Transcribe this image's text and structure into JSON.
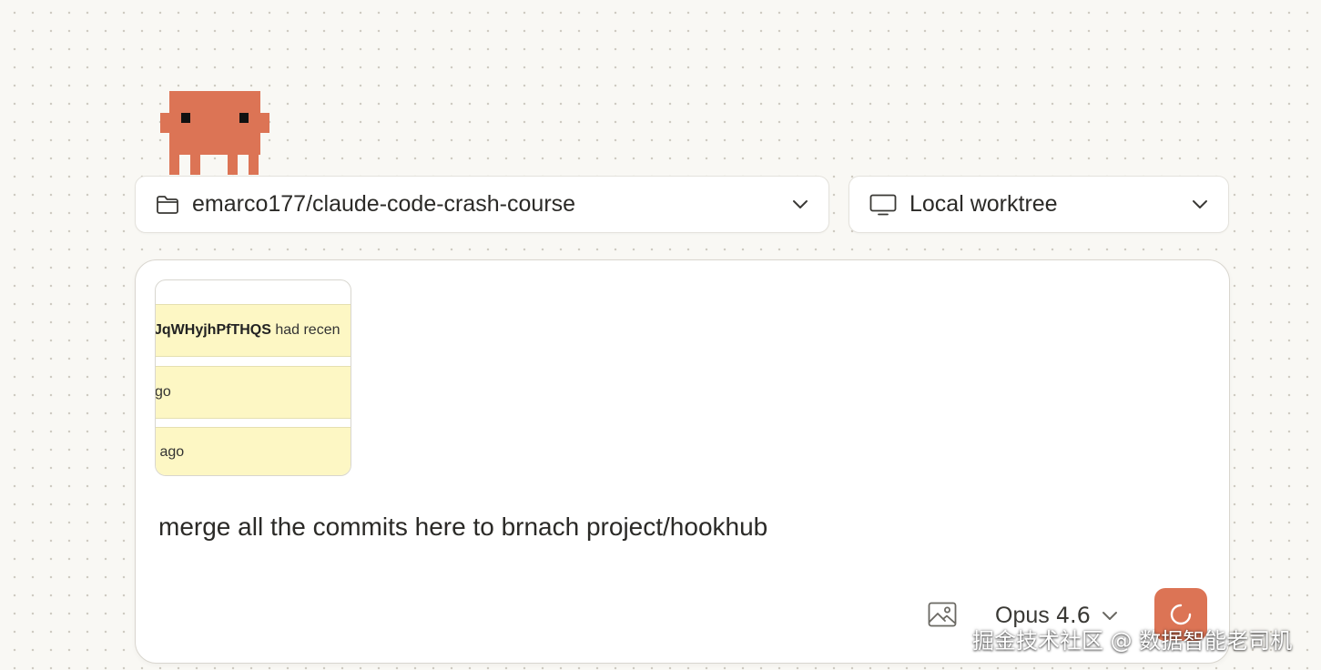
{
  "mascot": {
    "icon": "pixel-crab-mascot-icon",
    "color": "#dc7455"
  },
  "repo_selector": {
    "label": "emarco177/claude-code-crash-course",
    "icon": "folder-icon"
  },
  "worktree_selector": {
    "label": "Local worktree",
    "icon": "monitor-icon"
  },
  "composer": {
    "attachment": {
      "rows": [
        {
          "id_text": "JqWHyjhPfTHQS",
          "text": " had recen"
        },
        {
          "text": "go"
        },
        {
          "text": " ago"
        }
      ]
    },
    "prompt": "merge all the commits here to brnach project/hookhub",
    "toolbar": {
      "image_icon": "image-icon",
      "model_name": "Opus",
      "model_version": "4.6",
      "send_icon": "loading-spinner-icon"
    }
  },
  "watermark": "掘金技术社区 @ 数据智能老司机",
  "colors": {
    "accent": "#dc7455",
    "highlight": "#fdf7c4",
    "background": "#f9f8f4"
  }
}
